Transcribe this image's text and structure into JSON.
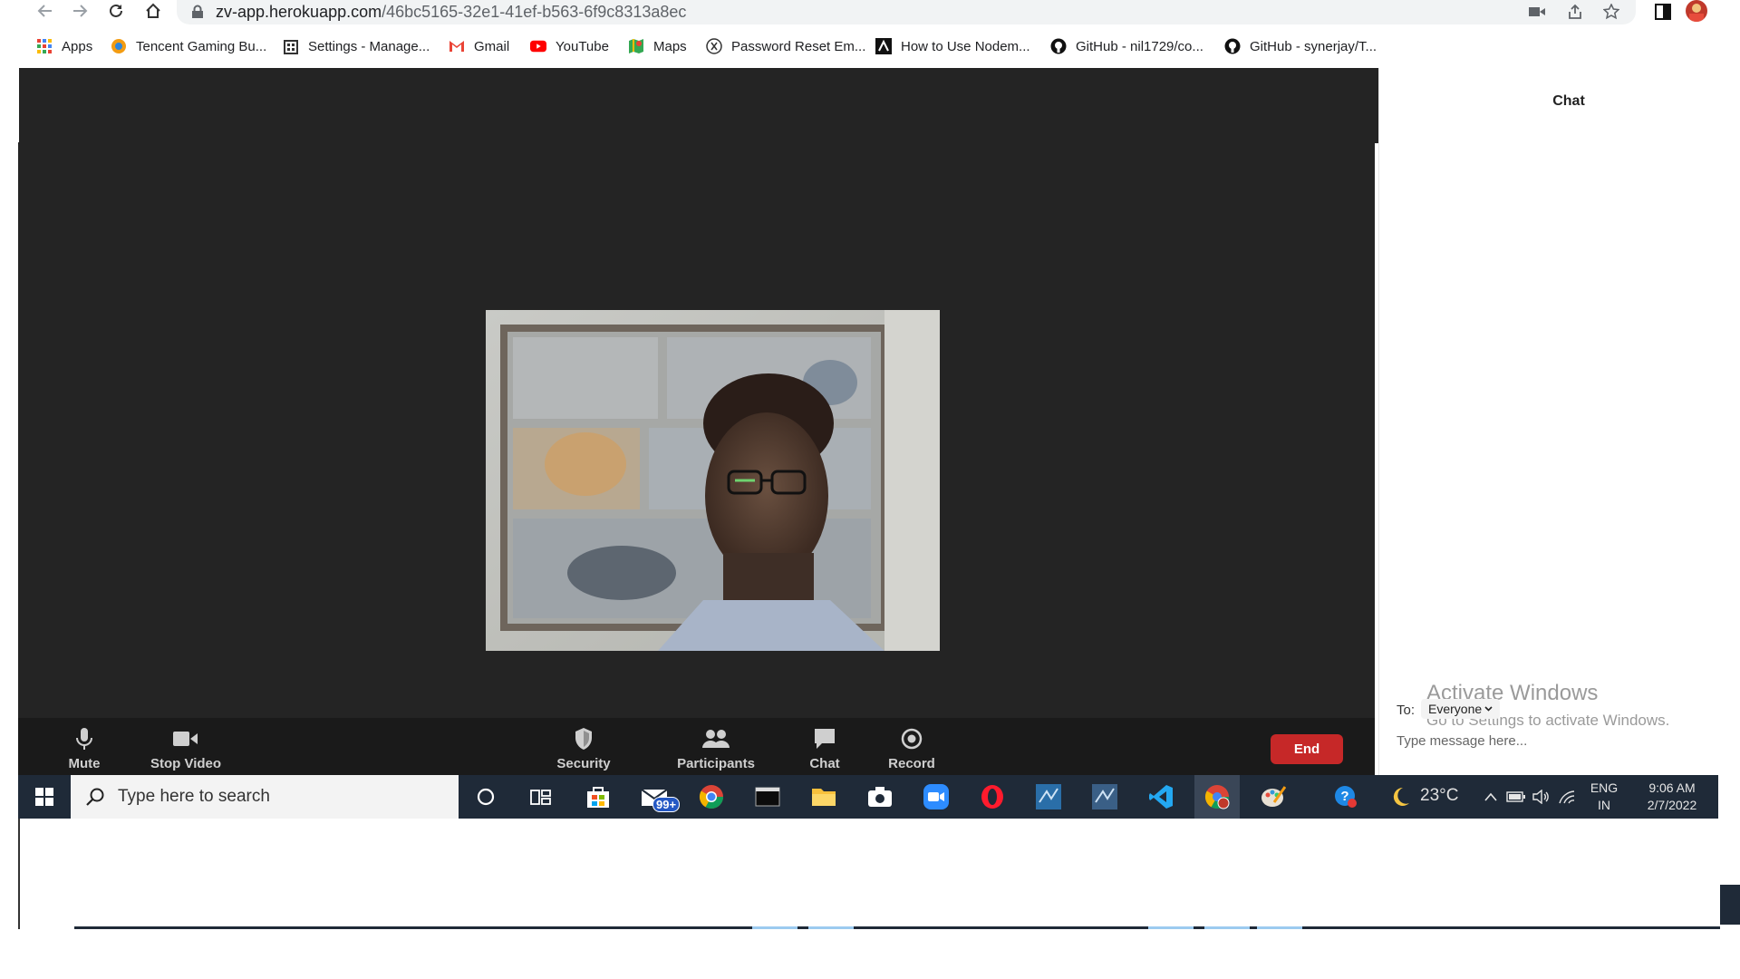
{
  "browser": {
    "url_host": "zv-app.herokuapp.com",
    "url_path": "/46bc5165-32e1-41ef-b563-6f9c8313a8ec"
  },
  "bookmarks": [
    {
      "label": "Apps",
      "icon": "apps-grid-icon"
    },
    {
      "label": "Tencent Gaming Bu...",
      "icon": "tencent-icon"
    },
    {
      "label": "Settings - Manage...",
      "icon": "building-icon"
    },
    {
      "label": "Gmail",
      "icon": "gmail-icon"
    },
    {
      "label": "YouTube",
      "icon": "youtube-icon"
    },
    {
      "label": "Maps",
      "icon": "maps-icon"
    },
    {
      "label": "Password Reset Em...",
      "icon": "x-circle-icon"
    },
    {
      "label": "How to Use Nodem...",
      "icon": "nodemailer-icon"
    },
    {
      "label": "GitHub - nil1729/co...",
      "icon": "github-icon"
    },
    {
      "label": "GitHub - synerjay/T...",
      "icon": "github-icon"
    }
  ],
  "toolbar": {
    "mute": "Mute",
    "stop_video": "Stop Video",
    "security": "Security",
    "participants": "Participants",
    "chat": "Chat",
    "record": "Record",
    "end": "End"
  },
  "chat": {
    "title": "Chat",
    "to_label": "To:",
    "recipient": "Everyone",
    "placeholder": "Type message here..."
  },
  "watermark": {
    "line1": "Activate Windows",
    "line2": "Go to Settings to activate Windows."
  },
  "taskbar": {
    "search_placeholder": "Type here to search",
    "mail_badge": "99+",
    "temperature": "23°C",
    "lang_top": "ENG",
    "lang_bottom": "IN",
    "time": "9:06 AM",
    "date": "2/7/2022"
  },
  "colors": {
    "stage_bg": "#242424",
    "toolbar_bg": "#1a1a1a",
    "end_button": "#c62828",
    "taskbar_bg": "#1f2a38"
  }
}
